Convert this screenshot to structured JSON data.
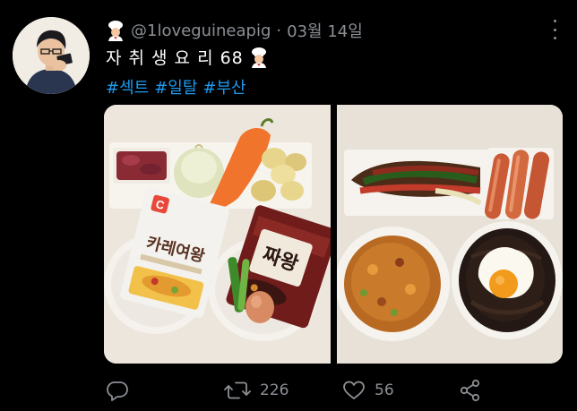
{
  "tweet": {
    "handle": "@1loveguineapig",
    "separator": "·",
    "date": "03월 14일",
    "text": "자 취 생 요 리 68",
    "hashtags": [
      "#섹트",
      "#일탈",
      "#부산"
    ],
    "link_color": "#1d9bf0"
  },
  "media": {
    "left_photo": {
      "pouch_brand": "C",
      "pouch_label": "카레여왕",
      "package_label": "짜왕"
    }
  },
  "actions": {
    "reply_icon": "reply-icon",
    "retweet_count": "226",
    "like_count": "56",
    "share_icon": "share-icon"
  }
}
